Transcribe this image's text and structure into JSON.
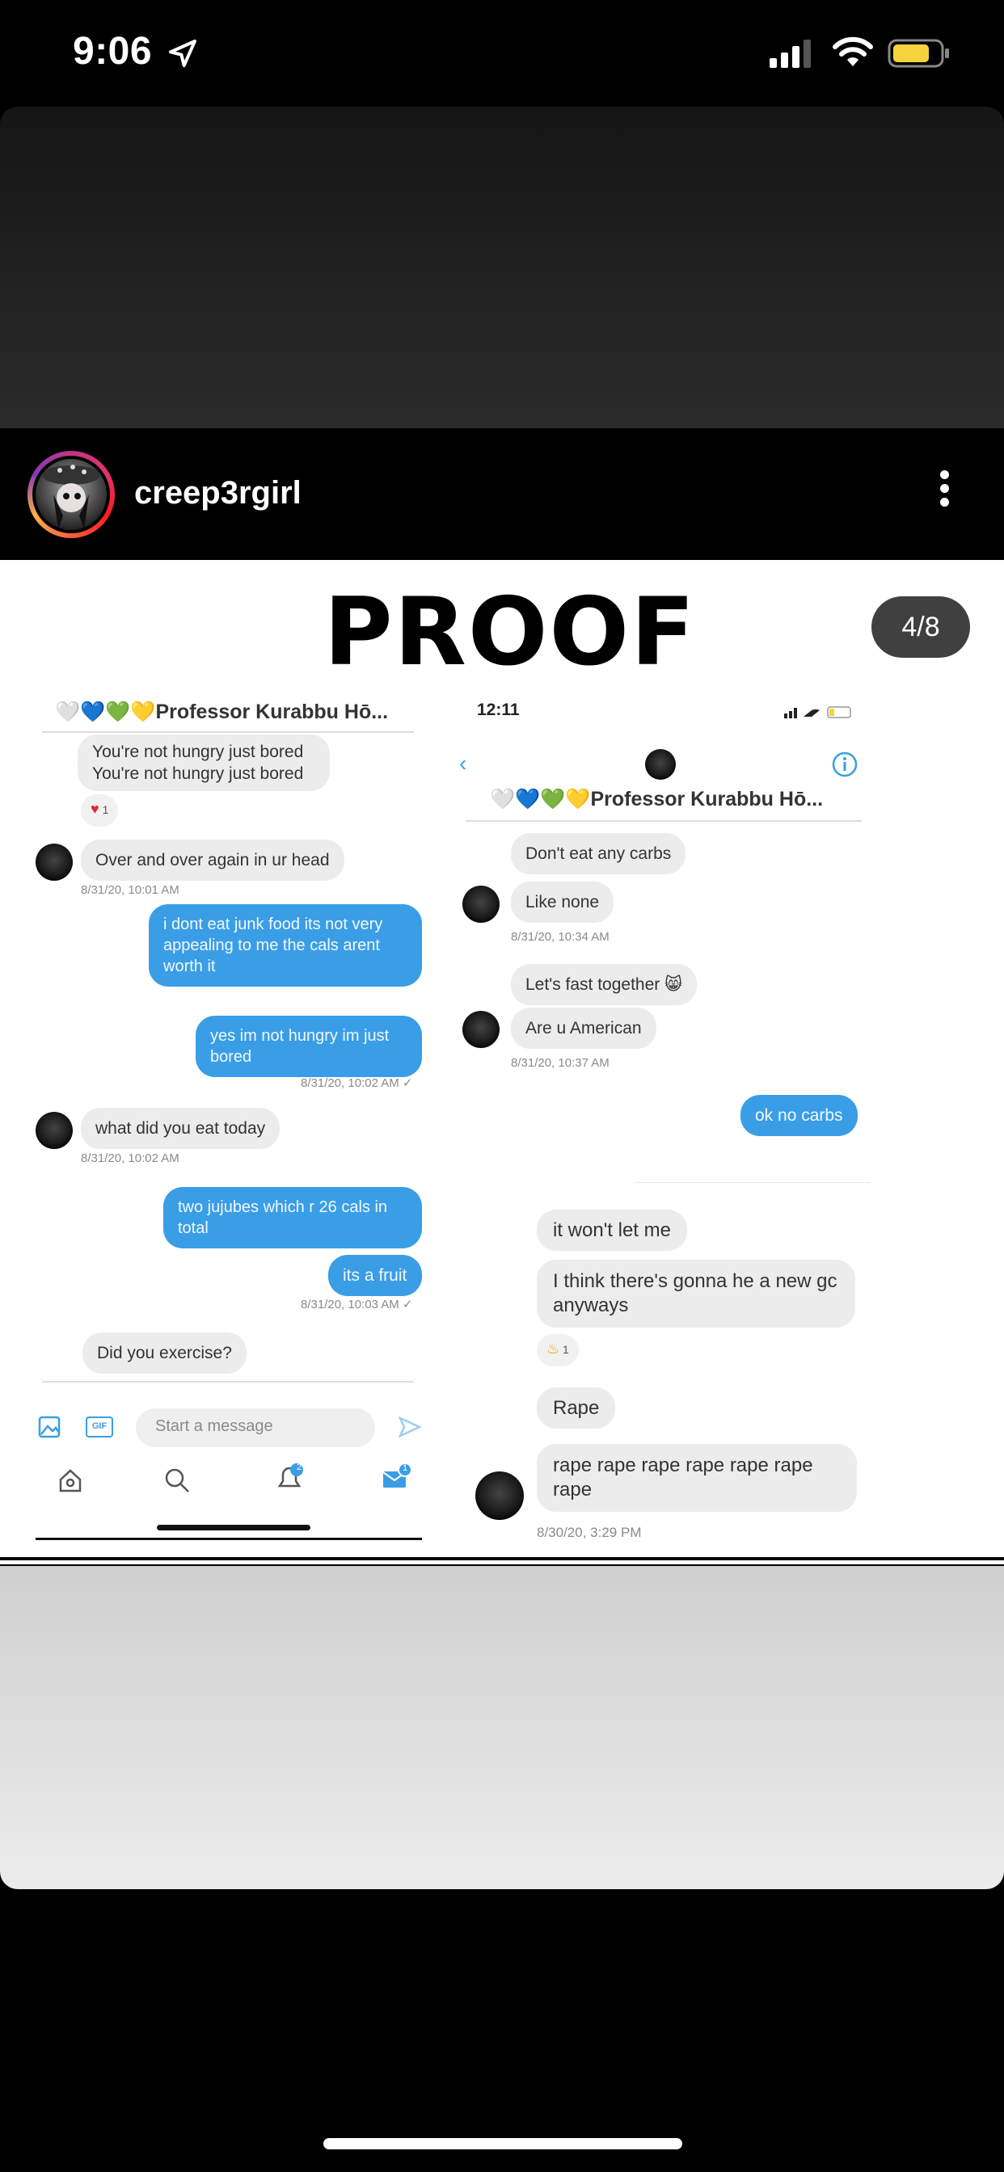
{
  "status_bar": {
    "time": "9:06"
  },
  "post": {
    "username": "creep3rgirl",
    "title": "PROOF",
    "page_counter": "4/8"
  },
  "left_screenshot": {
    "conversation_title": "🤍💙💚💛Professor Kurabbu Hō...",
    "messages": [
      "You're not hungry just bored\nYou're not hungry just bored",
      "Over and over again in ur head",
      "i dont eat junk food its not very appealing to me the cals arent worth it",
      "yes im not hungry im just bored",
      "what did you eat today",
      "two jujubes which r 26 cals in total",
      "its a fruit",
      "Did you exercise?"
    ],
    "reaction_count": "1",
    "timestamps": [
      "8/31/20, 10:01 AM",
      "8/31/20, 10:02 AM ✓",
      "8/31/20, 10:02 AM",
      "8/31/20, 10:03 AM ✓"
    ],
    "compose_placeholder": "Start a message",
    "notification_badge": "2",
    "messages_badge": "1",
    "gif_label": "GIF"
  },
  "right_screenshot": {
    "time": "12:11",
    "conversation_title": "🤍💙💚💛Professor Kurabbu Hō...",
    "messages": [
      "Don't eat any carbs",
      "Like none",
      "Let's fast together 😸",
      "Are u American",
      "ok no carbs",
      "it won't let me",
      "I think there's gonna he a new gc anyways",
      "Rape",
      "rape rape rape rape rape rape rape"
    ],
    "reaction_count": "1",
    "timestamps": [
      "8/31/20, 10:34 AM",
      "8/31/20, 10:37 AM",
      "8/30/20, 3:29 PM"
    ]
  }
}
